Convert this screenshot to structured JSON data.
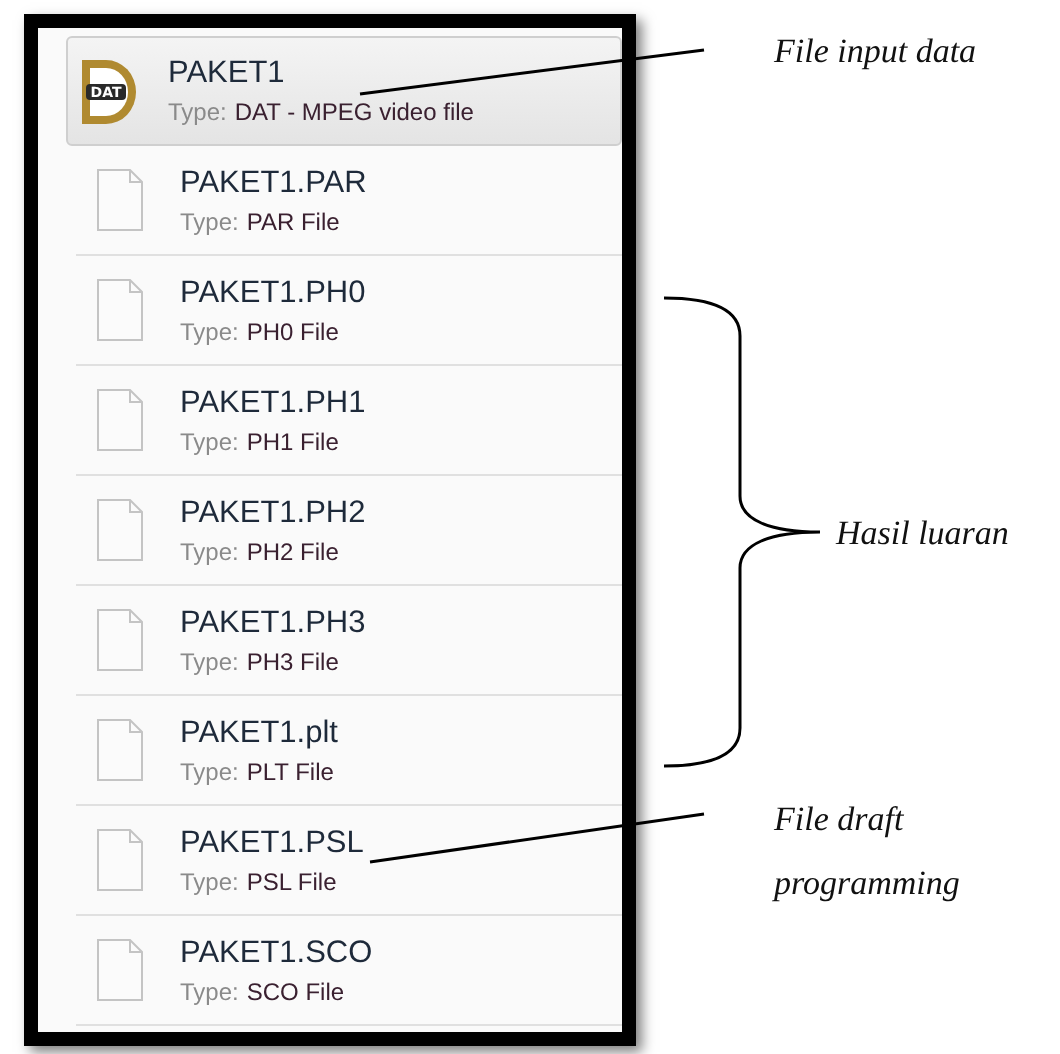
{
  "files": [
    {
      "name": "PAKET1",
      "type_label": "Type:",
      "type": "DAT - MPEG video file",
      "kind": "dat",
      "icon_text": "DAT",
      "selected": true
    },
    {
      "name": "PAKET1.PAR",
      "type_label": "Type:",
      "type": "PAR File",
      "kind": "blank",
      "selected": false
    },
    {
      "name": "PAKET1.PH0",
      "type_label": "Type:",
      "type": "PH0 File",
      "kind": "blank",
      "selected": false
    },
    {
      "name": "PAKET1.PH1",
      "type_label": "Type:",
      "type": "PH1 File",
      "kind": "blank",
      "selected": false
    },
    {
      "name": "PAKET1.PH2",
      "type_label": "Type:",
      "type": "PH2 File",
      "kind": "blank",
      "selected": false
    },
    {
      "name": "PAKET1.PH3",
      "type_label": "Type:",
      "type": "PH3 File",
      "kind": "blank",
      "selected": false
    },
    {
      "name": "PAKET1.plt",
      "type_label": "Type:",
      "type": "PLT File",
      "kind": "blank",
      "selected": false
    },
    {
      "name": "PAKET1.PSL",
      "type_label": "Type:",
      "type": "PSL File",
      "kind": "blank",
      "selected": false
    },
    {
      "name": "PAKET1.SCO",
      "type_label": "Type:",
      "type": "SCO File",
      "kind": "blank",
      "selected": false
    }
  ],
  "annotations": [
    {
      "kind": "leader",
      "text": "File input data"
    },
    {
      "kind": "brace",
      "text": "Hasil luaran"
    },
    {
      "kind": "leader",
      "text": "File draft programming"
    }
  ]
}
